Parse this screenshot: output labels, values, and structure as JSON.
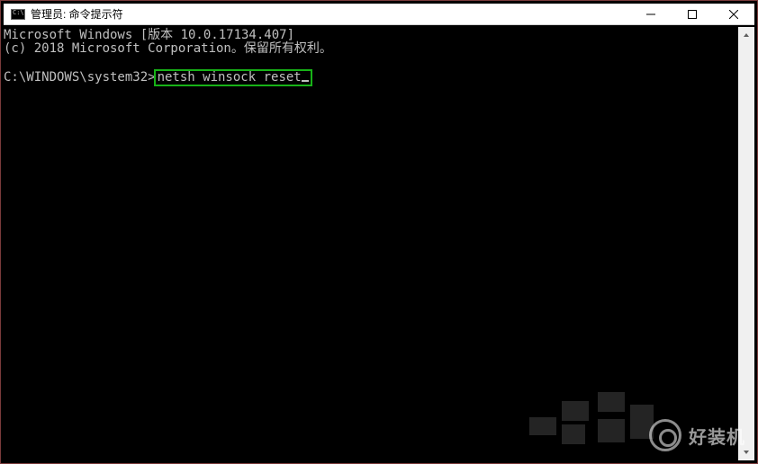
{
  "title": "管理员: 命令提示符",
  "window_buttons": {
    "minimize": "minimize",
    "maximize": "maximize",
    "close": "close"
  },
  "terminal": {
    "line1": "Microsoft Windows [版本 10.0.17134.407]",
    "line2": "(c) 2018 Microsoft Corporation。保留所有权利。",
    "prompt": "C:\\WINDOWS\\system32>",
    "command": "netsh winsock reset"
  },
  "watermark": {
    "text": "好装机"
  }
}
